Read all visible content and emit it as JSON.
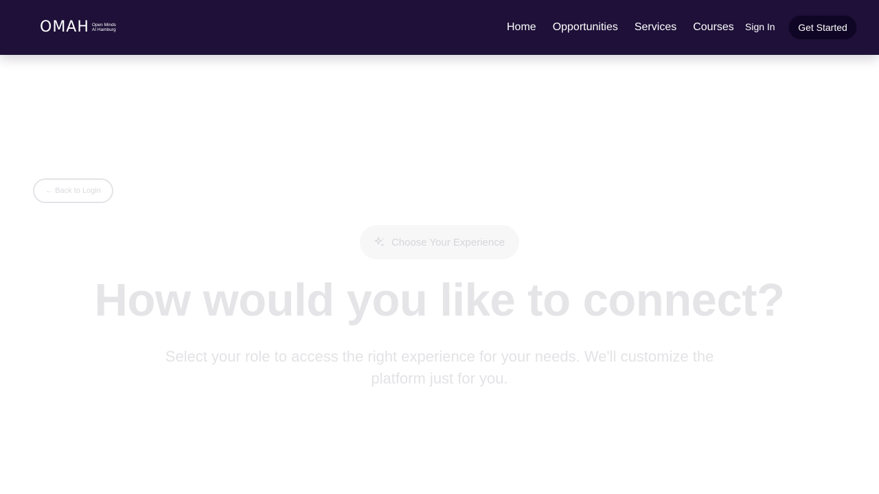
{
  "header": {
    "logo": {
      "mark": "OMAH",
      "tagline_line1": "Open Minds",
      "tagline_line2": "AI Hamburg"
    },
    "nav": [
      {
        "label": "Home"
      },
      {
        "label": "Opportunities"
      },
      {
        "label": "Services"
      },
      {
        "label": "Courses"
      }
    ],
    "sign_in_label": "Sign In",
    "get_started_label": "Get Started"
  },
  "main": {
    "back_button_label": "Back to Login",
    "back_arrow": "←",
    "badge": {
      "icon": "sparkle-icon",
      "label": "Choose Your Experience"
    },
    "headline": "How would you like to connect?",
    "subtitle": "Select your role to access the right experience for your needs. We'll customize the platform just for you."
  },
  "colors": {
    "navbar_bg": "#1e1038",
    "cta_bg": "#0f0524",
    "faded_text": "#e5e5e8"
  }
}
